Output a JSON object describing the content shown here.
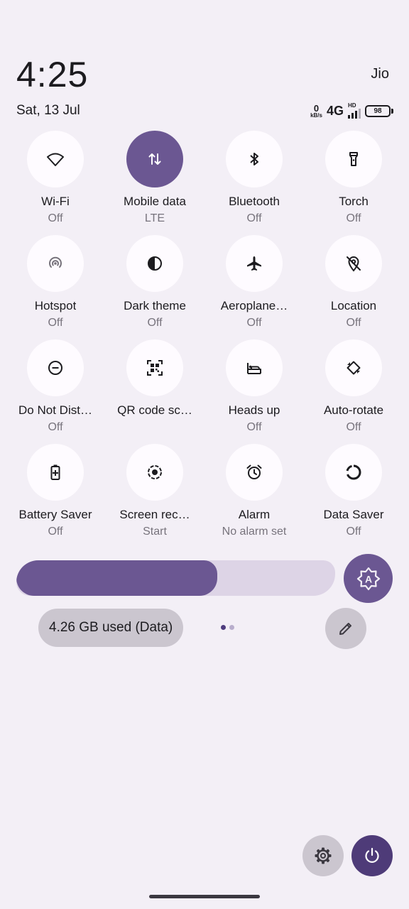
{
  "header": {
    "time": "4:25",
    "carrier": "Jio",
    "date": "Sat, 13 Jul"
  },
  "status_bar": {
    "speed_value": "0",
    "speed_unit": "kB/s",
    "network": "4G",
    "hd_label": "HD",
    "battery": "98"
  },
  "tiles": [
    {
      "label": "Wi-Fi",
      "status": "Off",
      "icon": "wifi-icon",
      "active": false
    },
    {
      "label": "Mobile data",
      "status": "LTE",
      "icon": "mobile-data-icon",
      "active": true
    },
    {
      "label": "Bluetooth",
      "status": "Off",
      "icon": "bluetooth-icon",
      "active": false
    },
    {
      "label": "Torch",
      "status": "Off",
      "icon": "torch-icon",
      "active": false
    },
    {
      "label": "Hotspot",
      "status": "Off",
      "icon": "hotspot-icon",
      "active": false
    },
    {
      "label": "Dark theme",
      "status": "Off",
      "icon": "dark-theme-icon",
      "active": false
    },
    {
      "label": "Aeroplane…",
      "status": "Off",
      "icon": "aeroplane-icon",
      "active": false
    },
    {
      "label": "Location",
      "status": "Off",
      "icon": "location-off-icon",
      "active": false
    },
    {
      "label": "Do Not Dist…",
      "status": "Off",
      "icon": "do-not-disturb-icon",
      "active": false
    },
    {
      "label": "QR code sc…",
      "status": "",
      "icon": "qr-code-icon",
      "active": false
    },
    {
      "label": "Heads up",
      "status": "Off",
      "icon": "heads-up-icon",
      "active": false
    },
    {
      "label": "Auto-rotate",
      "status": "Off",
      "icon": "auto-rotate-icon",
      "active": false
    },
    {
      "label": "Battery Saver",
      "status": "Off",
      "icon": "battery-saver-icon",
      "active": false
    },
    {
      "label": "Screen rec…",
      "status": "Start",
      "icon": "screen-record-icon",
      "active": false
    },
    {
      "label": "Alarm",
      "status": "No alarm set",
      "icon": "alarm-icon",
      "active": false
    },
    {
      "label": "Data Saver",
      "status": "Off",
      "icon": "data-saver-icon",
      "active": false
    }
  ],
  "brightness": {
    "level": 0.63,
    "auto_icon": "auto-brightness-icon"
  },
  "data_usage": {
    "label": "4.26 GB used (Data)"
  },
  "pager": {
    "pages": 2,
    "current": 1
  },
  "colors": {
    "accent": "#6b5792",
    "background": "#f3eff6",
    "tile_off": "#fefbff",
    "power": "#4e3b78"
  }
}
